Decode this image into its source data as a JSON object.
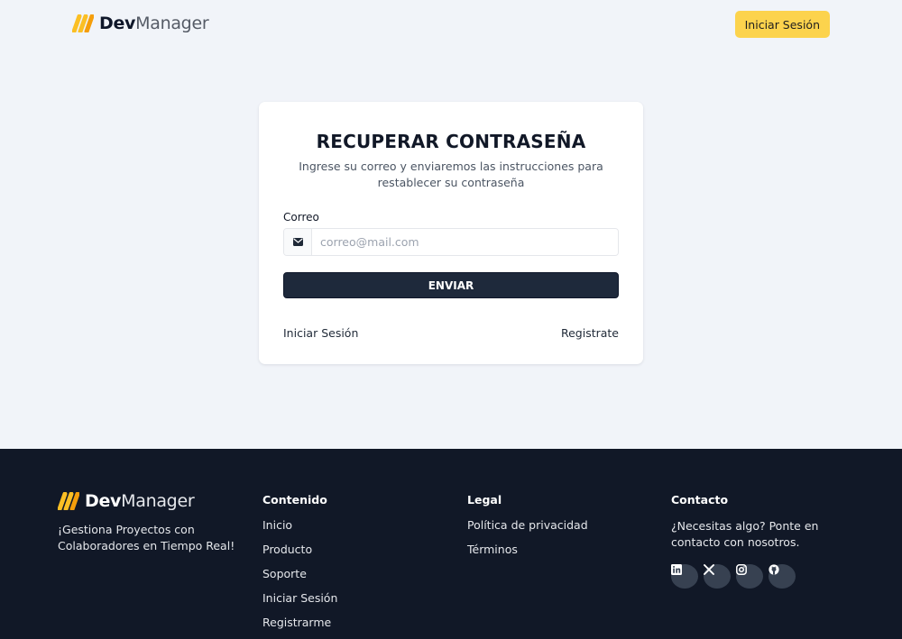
{
  "brand": {
    "bold": "Dev",
    "regular": "Manager",
    "logo_icon": "m-logo-icon",
    "accent_color": "#fcd34d"
  },
  "header": {
    "login_label": "Iniciar Sesión"
  },
  "card": {
    "title": "RECUPERAR CONTRASEÑA",
    "subtitle": "Ingrese su correo y enviaremos las instrucciones para restablecer su contraseña",
    "email_label": "Correo",
    "email_placeholder": "correo@mail.com",
    "email_value": "",
    "email_icon": "envelope-icon",
    "submit_label": "ENVIAR",
    "login_link": "Iniciar Sesión",
    "register_link": "Registrate"
  },
  "footer": {
    "tagline": "¡Gestiona Proyectos con Colaboradores en Tiempo Real!",
    "contenido": {
      "heading": "Contenido",
      "links": [
        "Inicio",
        "Producto",
        "Soporte",
        "Iniciar Sesión",
        "Registrarme"
      ]
    },
    "legal": {
      "heading": "Legal",
      "links": [
        "Política de privacidad",
        "Términos"
      ]
    },
    "contacto": {
      "heading": "Contacto",
      "text": "¿Necesitas algo? Ponte en contacto con nosotros.",
      "socials": [
        "linkedin-icon",
        "x-icon",
        "instagram-icon",
        "github-icon"
      ]
    }
  }
}
